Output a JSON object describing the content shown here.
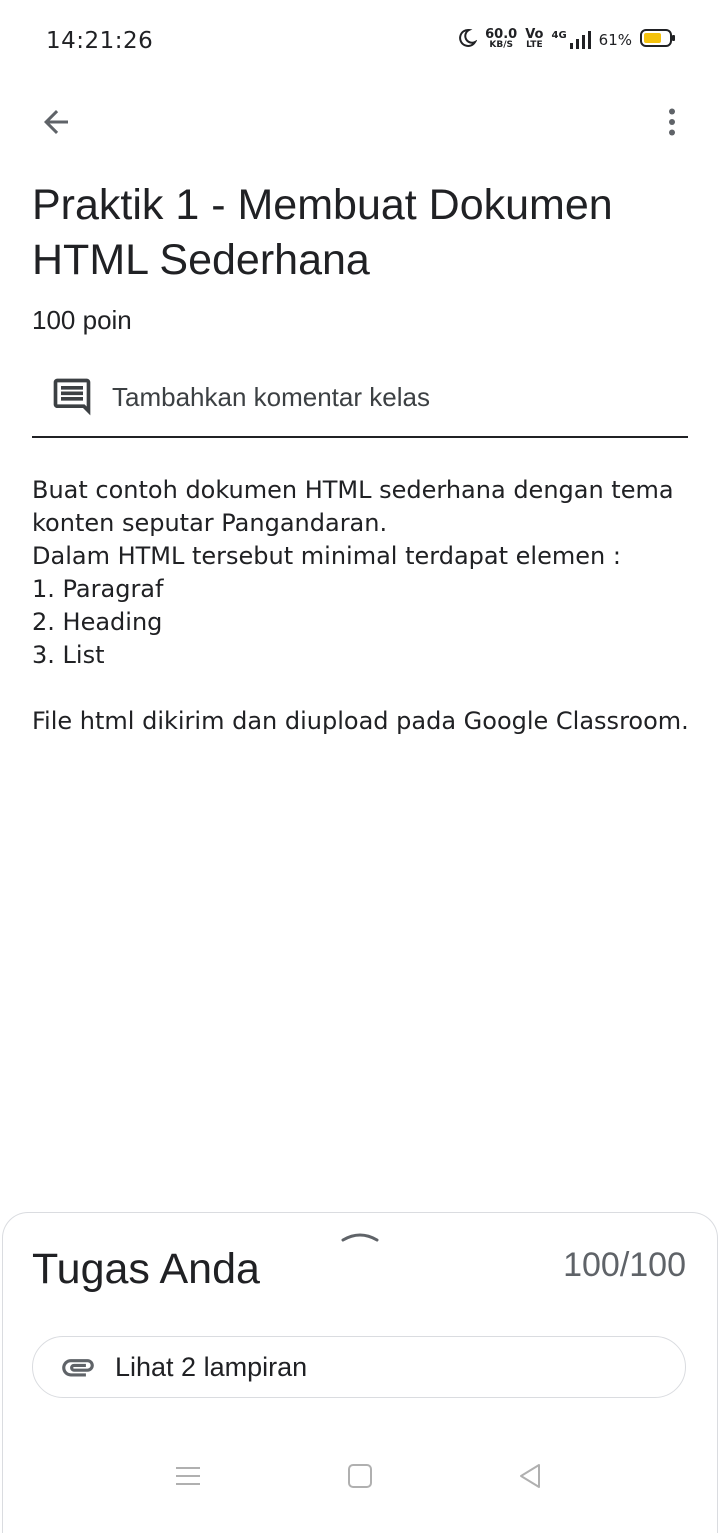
{
  "status_bar": {
    "time": "14:21:26",
    "net_speed_value": "60.0",
    "net_speed_unit": "KB/S",
    "volte_top": "Vo",
    "volte_bottom": "LTE",
    "network": "4G",
    "battery": "61%",
    "icons": [
      "moon-icon",
      "signal-icon",
      "battery-icon"
    ],
    "battery_color": "#f4c20d"
  },
  "app_bar": {
    "icons": [
      "arrow-back-icon",
      "more-vert-icon"
    ]
  },
  "assignment": {
    "title": "Praktik 1 - Membuat Dokumen HTML Sederhana",
    "points": "100 poin",
    "class_comment_label": "Tambahkan komentar kelas",
    "description_lines": [
      "Buat contoh dokumen HTML sederhana dengan tema konten seputar Pangandaran.",
      "Dalam HTML tersebut minimal terdapat elemen :",
      "1. Paragraf",
      "2. Heading",
      "3. List",
      "",
      "File html dikirim dan diupload pada Google Classroom."
    ]
  },
  "your_work": {
    "title": "Tugas Anda",
    "score": "100/100",
    "attachments_label": "Lihat 2 lampiran",
    "icons": [
      "chevron-up-icon",
      "attachment-icon"
    ]
  },
  "nav_bar": {
    "icons": [
      "menu-icon",
      "home-icon",
      "back-triangle-icon"
    ]
  }
}
